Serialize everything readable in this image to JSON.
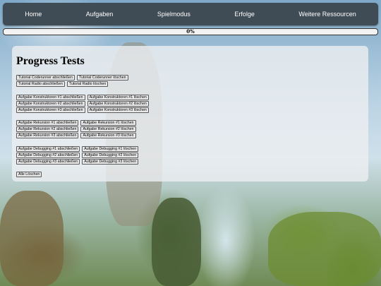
{
  "nav": {
    "items": [
      "Home",
      "Aufgaben",
      "Spielmodus",
      "Erfolge",
      "Weitere Ressourcen"
    ]
  },
  "progress": {
    "value_text": "0%",
    "fraction": 0.0
  },
  "page": {
    "title": "Progress Tests"
  },
  "groups": [
    [
      [
        "Tutorial Coderunner abschließen",
        "Tutorial Coderunner löschen"
      ],
      [
        "Tutorial Radio abschließen",
        "Tutorial Radio löschen"
      ]
    ],
    [
      [
        "Aufgabe Konstruktoren #1 abschließen",
        "Aufgabe Konstruktoren #1 löschen"
      ],
      [
        "Aufgabe Konstruktoren #2 abschließen",
        "Aufgabe Konstruktoren #2 löschen"
      ],
      [
        "Aufgabe Konstruktoren #3 abschließen",
        "Aufgabe Konstruktoren #3 löschen"
      ]
    ],
    [
      [
        "Aufgabe Rekursion #1 abschließen",
        "Aufgabe Rekursion #1 löschen"
      ],
      [
        "Aufgabe Rekursion #2 abschließen",
        "Aufgabe Rekursion #2 löschen"
      ],
      [
        "Aufgabe Rekursion #3 abschließen",
        "Aufgabe Rekursion #3 löschen"
      ]
    ],
    [
      [
        "Aufgabe Debugging #1 abschließen",
        "Aufgabe Debugging #1 löschen"
      ],
      [
        "Aufgabe Debugging #2 abschließen",
        "Aufgabe Debugging #2 löschen"
      ],
      [
        "Aufgabe Debugging #3 abschließen",
        "Aufgabe Debugging #3 löschen"
      ]
    ]
  ],
  "clear_all_label": "Alle Löschen",
  "colors": {
    "navbar": "#3f4c55",
    "panel": "#ebeef0"
  }
}
